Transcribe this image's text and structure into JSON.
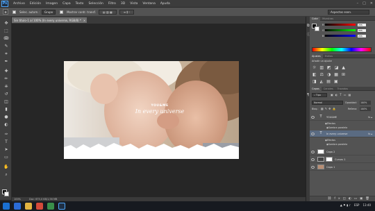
{
  "app": {
    "logo": "Ps"
  },
  "menu": [
    "Archivo",
    "Edición",
    "Imagen",
    "Capa",
    "Texto",
    "Selección",
    "Filtro",
    "3D",
    "Vista",
    "Ventana",
    "Ayuda"
  ],
  "window_controls": [
    "–",
    "□",
    "✕"
  ],
  "options_bar": {
    "auto_select_label": "Selec. autom.:",
    "auto_select_value": "Grupo",
    "transform_label": "Mostrar contr. transf.",
    "workspace": "Aspectos esen."
  },
  "document_tab": {
    "title": "Sin título-1 al 100% (In every universe, RGB/8) *",
    "close": "×"
  },
  "canvas": {
    "text_top": "YOU&ME",
    "text_script": "In every universe"
  },
  "status_bar": {
    "zoom": "100%",
    "doc": "Doc: 675,0 KB/1,56 MB"
  },
  "color_panel": {
    "tabs": [
      "Color",
      "Muestras"
    ],
    "channels": [
      {
        "label": "R",
        "value": "255",
        "gradient": "linear-gradient(90deg,#000,#f00)"
      },
      {
        "label": "G",
        "value": "255",
        "gradient": "linear-gradient(90deg,#000,#0f0)"
      },
      {
        "label": "B",
        "value": "255",
        "gradient": "linear-gradient(90deg,#000,#00f)"
      }
    ]
  },
  "adjust_panel": {
    "tabs": [
      "Ajustes",
      "Estilos"
    ],
    "title": "Añadir un ajuste"
  },
  "layers_panel": {
    "tabs": [
      "Capas",
      "Canales",
      "Trazados"
    ],
    "kind_label": "Tipo",
    "blend_mode": "Normal",
    "opacity_label": "Opacidad:",
    "opacity_value": "100%",
    "lock_label": "Bloq.:",
    "fill_label": "Relleno:",
    "fill_value": "100%",
    "layers": [
      {
        "name": "YOU&ME",
        "kind": "text",
        "fx": true,
        "selected": false
      },
      {
        "name": "In every universe",
        "kind": "text",
        "fx": true,
        "selected": true
      },
      {
        "name": "Capa 2",
        "kind": "pixel",
        "fx": false,
        "selected": false
      },
      {
        "name": "Curvas 1",
        "kind": "adjustment",
        "fx": false,
        "selected": false
      },
      {
        "name": "Capa 1",
        "kind": "pixel",
        "fx": false,
        "selected": false
      }
    ],
    "effects_label": "Efectos",
    "shadow_label": "Sombra paralela"
  },
  "taskbar": {
    "lang": "ESP",
    "time": "13:40"
  },
  "colors": {
    "accent": "#5a6b82",
    "ps_blue": "#4fa9ff"
  }
}
